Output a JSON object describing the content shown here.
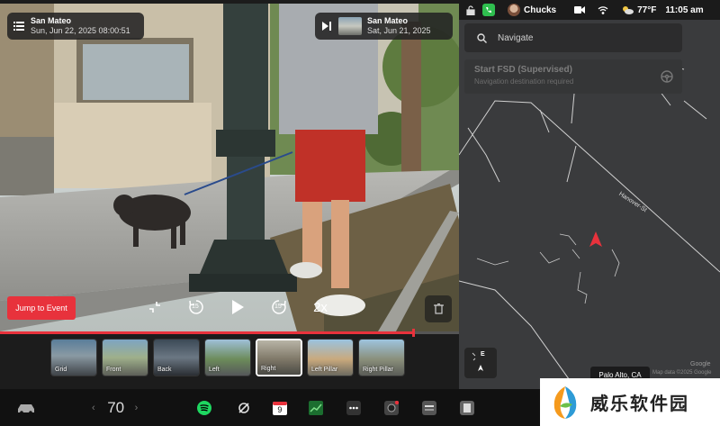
{
  "viewer": {
    "current_clip": {
      "location": "San Mateo",
      "datetime": "Sun, Jun 22, 2025 08:00:51"
    },
    "next_clip": {
      "location": "San Mateo",
      "date": "Sat, Jun 21, 2025"
    },
    "jump_label": "Jump to Event",
    "skip_back_label": "15",
    "skip_forward_label": "15",
    "speed_label": "2x",
    "progress": 0.9,
    "cameras": [
      {
        "label": "Grid",
        "active": false
      },
      {
        "label": "Front",
        "active": false
      },
      {
        "label": "Back",
        "active": false
      },
      {
        "label": "Left",
        "active": false
      },
      {
        "label": "Right",
        "active": true
      },
      {
        "label": "Left Pillar",
        "active": false
      },
      {
        "label": "Right Pillar",
        "active": false
      }
    ]
  },
  "status_bar": {
    "profile_name": "Chucks",
    "temperature": "77°F",
    "time": "11:05 am"
  },
  "map": {
    "search_placeholder": "Navigate",
    "fsd_title": "Start FSD (Supervised)",
    "fsd_subtitle": "Navigation destination required",
    "street_label": "Hanover-St",
    "compass_letter_e": "E",
    "location": "Palo Alto, CA",
    "google_mark": "Google",
    "copyright": "Map data ©2025 Google",
    "accent_color": "#e8323c"
  },
  "taskbar": {
    "temperature_setting": "70",
    "calendar_day": "9"
  },
  "watermark": {
    "text": "威乐软件园"
  }
}
